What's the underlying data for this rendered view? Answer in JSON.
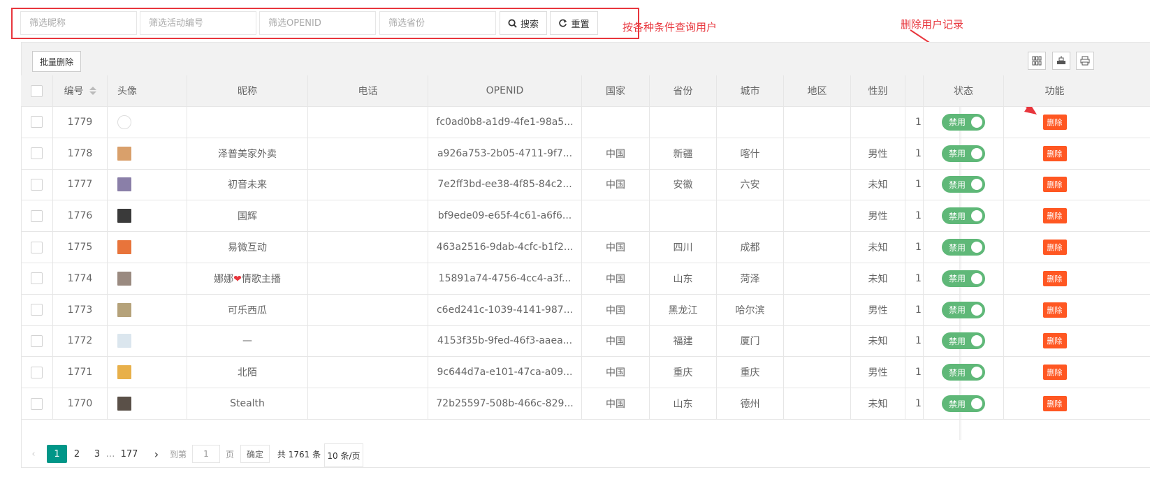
{
  "filters": {
    "nickname_placeholder": "筛选昵称",
    "activity_placeholder": "筛选活动编号",
    "openid_placeholder": "筛选OPENID",
    "province_placeholder": "筛选省份",
    "search_label": "搜索",
    "reset_label": "重置"
  },
  "annotations": {
    "query_note": "按各种条件查询用户",
    "delete_note": "删除用户记录"
  },
  "toolbar": {
    "batch_delete": "批量删除"
  },
  "columns": {
    "id": "编号",
    "avatar": "头像",
    "nickname": "昵称",
    "phone": "电话",
    "openid": "OPENID",
    "country": "国家",
    "province": "省份",
    "city": "城市",
    "district": "地区",
    "gender": "性别",
    "status": "状态",
    "action": "功能"
  },
  "rows": [
    {
      "id": "1779",
      "nickname": "",
      "openid": "fc0ad0b8-a1d9-4fe1-98a5...",
      "country": "",
      "province": "",
      "city": "",
      "gender": "",
      "extra": "1!",
      "status": "禁用",
      "action": "删除",
      "avatar_color": "#ffffff"
    },
    {
      "id": "1778",
      "nickname": "泽普美家外卖",
      "openid": "a926a753-2b05-4711-9f7...",
      "country": "中国",
      "province": "新疆",
      "city": "喀什",
      "gender": "男性",
      "extra": "1!",
      "status": "禁用",
      "action": "删除",
      "avatar_color": "#d9a06b"
    },
    {
      "id": "1777",
      "nickname": "初音未来",
      "openid": "7e2ff3bd-ee38-4f85-84c2...",
      "country": "中国",
      "province": "安徽",
      "city": "六安",
      "gender": "未知",
      "extra": "1!",
      "status": "禁用",
      "action": "删除",
      "avatar_color": "#8a7fa8"
    },
    {
      "id": "1776",
      "nickname": "国辉",
      "openid": "bf9ede09-e65f-4c61-a6f6...",
      "country": "",
      "province": "",
      "city": "",
      "gender": "男性",
      "extra": "1!",
      "status": "禁用",
      "action": "删除",
      "avatar_color": "#3a3a3a"
    },
    {
      "id": "1775",
      "nickname": "易微互动",
      "openid": "463a2516-9dab-4cfc-b1f2...",
      "country": "中国",
      "province": "四川",
      "city": "成都",
      "gender": "未知",
      "extra": "1!",
      "status": "禁用",
      "action": "删除",
      "avatar_color": "#e8743b"
    },
    {
      "id": "1774",
      "nickname": "娜娜❤情歌主播",
      "openid": "15891a74-4756-4cc4-a3f...",
      "country": "中国",
      "province": "山东",
      "city": "菏泽",
      "gender": "未知",
      "extra": "1!",
      "status": "禁用",
      "action": "删除",
      "avatar_color": "#9a8a80"
    },
    {
      "id": "1773",
      "nickname": "可乐西瓜",
      "openid": "c6ed241c-1039-4141-987...",
      "country": "中国",
      "province": "黑龙江",
      "city": "哈尔滨",
      "gender": "男性",
      "extra": "1!",
      "status": "禁用",
      "action": "删除",
      "avatar_color": "#b5a27a"
    },
    {
      "id": "1772",
      "nickname": "—",
      "openid": "4153f35b-9fed-46f3-aaea...",
      "country": "中国",
      "province": "福建",
      "city": "厦门",
      "gender": "未知",
      "extra": "1!",
      "status": "禁用",
      "action": "删除",
      "avatar_color": "#dbe6ee"
    },
    {
      "id": "1771",
      "nickname": "北陌",
      "openid": "9c644d7a-e101-47ca-a09...",
      "country": "中国",
      "province": "重庆",
      "city": "重庆",
      "gender": "男性",
      "extra": "1!",
      "status": "禁用",
      "action": "删除",
      "avatar_color": "#e8b04a"
    },
    {
      "id": "1770",
      "nickname": "Stealth",
      "openid": "72b25597-508b-466c-829...",
      "country": "中国",
      "province": "山东",
      "city": "德州",
      "gender": "未知",
      "extra": "1!",
      "status": "禁用",
      "action": "删除",
      "avatar_color": "#5a5048"
    }
  ],
  "pagination": {
    "prev": "‹",
    "next": "›",
    "pages": [
      "1",
      "2",
      "3"
    ],
    "ellipsis": "…",
    "last": "177",
    "goto_label": "到第",
    "goto_value": "1",
    "page_label": "页",
    "confirm": "确定",
    "total": "共 1761 条",
    "per_page": "10 条/页"
  }
}
